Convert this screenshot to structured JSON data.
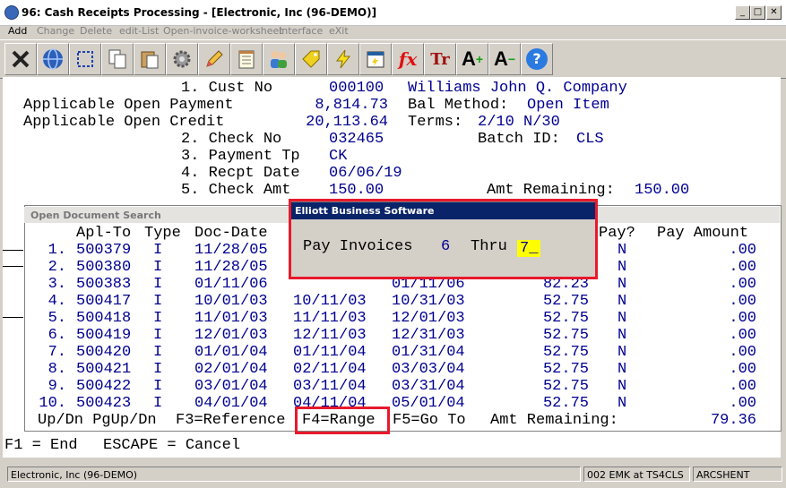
{
  "window": {
    "title": "96: Cash Receipts Processing - [Electronic, Inc (96-DEMO)]",
    "minimize_glyph": "_",
    "maximize_glyph": "□",
    "close_glyph": "✕"
  },
  "menu": [
    "Add",
    "Change",
    "Delete",
    "edit-List",
    "Open-invoice-worksheet",
    "Interface",
    "eXit"
  ],
  "toolbar": {
    "icons": [
      "exit-icon",
      "globe-icon",
      "select-icon",
      "copy-icon",
      "paste-icon",
      "settings-icon",
      "edit-icon",
      "notepad-icon",
      "users-icon",
      "tag-icon",
      "lightning-icon",
      "calendar-icon",
      "fx-icon",
      "font-icon",
      "font-larger-icon",
      "font-smaller-icon",
      "help-icon"
    ],
    "fx_label": "fx",
    "font_label": "Tr",
    "font_larger_label": "A",
    "font_larger_mark": "+",
    "font_smaller_label": "A",
    "font_smaller_mark": "−",
    "help_label": "?"
  },
  "header": {
    "cust_no_label": "1. Cust No",
    "cust_no": "000100",
    "customer_name": "Williams John Q. Company",
    "open_payment_label": "Applicable Open Payment",
    "open_payment": "8,814.73",
    "bal_method_label": "Bal Method:",
    "bal_method": "Open Item",
    "open_credit_label": "Applicable Open Credit",
    "open_credit": "20,113.64",
    "terms_label": "Terms:",
    "terms": "2/10 N/30",
    "check_no_label": "2. Check No",
    "check_no": "032465",
    "batch_label": "Batch ID:",
    "batch_id": "CLS",
    "payment_tp_label": "3. Payment Tp",
    "payment_tp": "CK",
    "recpt_date_label": "4. Recpt Date",
    "recpt_date": "06/06/19",
    "check_amt_label": "5. Check Amt",
    "check_amt": "150.00",
    "amt_remaining_label": "Amt Remaining:",
    "amt_remaining": "150.00"
  },
  "doc_search": {
    "title": "Open Document Search",
    "col_apl_to": "Apl-To",
    "col_type": "Type",
    "col_doc_date": "Doc-Date",
    "col_pay": "Pay?",
    "col_pay_amount": "Pay Amount",
    "rows": [
      {
        "n": "1.",
        "apl": "500379",
        "type": "I",
        "doc": "11/28/05",
        "disc": "",
        "due": "",
        "amt": "",
        "pay": "N",
        "pay_amt": ".00"
      },
      {
        "n": "2.",
        "apl": "500380",
        "type": "I",
        "doc": "11/28/05",
        "disc": "",
        "due": "",
        "amt": "",
        "pay": "N",
        "pay_amt": ".00"
      },
      {
        "n": "3.",
        "apl": "500383",
        "type": "I",
        "doc": "01/11/06",
        "disc": "",
        "due": "01/11/06",
        "amt": "82.23",
        "pay": "N",
        "pay_amt": ".00"
      },
      {
        "n": "4.",
        "apl": "500417",
        "type": "I",
        "doc": "10/01/03",
        "disc": "10/11/03",
        "due": "10/31/03",
        "amt": "52.75",
        "pay": "N",
        "pay_amt": ".00"
      },
      {
        "n": "5.",
        "apl": "500418",
        "type": "I",
        "doc": "11/01/03",
        "disc": "11/11/03",
        "due": "12/01/03",
        "amt": "52.75",
        "pay": "N",
        "pay_amt": ".00"
      },
      {
        "n": "6.",
        "apl": "500419",
        "type": "I",
        "doc": "12/01/03",
        "disc": "12/11/03",
        "due": "12/31/03",
        "amt": "52.75",
        "pay": "N",
        "pay_amt": ".00"
      },
      {
        "n": "7.",
        "apl": "500420",
        "type": "I",
        "doc": "01/01/04",
        "disc": "01/11/04",
        "due": "01/31/04",
        "amt": "52.75",
        "pay": "N",
        "pay_amt": ".00"
      },
      {
        "n": "8.",
        "apl": "500421",
        "type": "I",
        "doc": "02/01/04",
        "disc": "02/11/04",
        "due": "03/03/04",
        "amt": "52.75",
        "pay": "N",
        "pay_amt": ".00"
      },
      {
        "n": "9.",
        "apl": "500422",
        "type": "I",
        "doc": "03/01/04",
        "disc": "03/11/04",
        "due": "03/31/04",
        "amt": "52.75",
        "pay": "N",
        "pay_amt": ".00"
      },
      {
        "n": "10.",
        "apl": "500423",
        "type": "I",
        "doc": "04/01/04",
        "disc": "04/11/04",
        "due": "05/01/04",
        "amt": "52.75",
        "pay": "N",
        "pay_amt": ".00"
      }
    ],
    "footer": {
      "nav": "Up/Dn PgUp/Dn",
      "f3": "F3=Reference",
      "f4": "F4=Range",
      "f5": "F5=Go To",
      "remaining_label": "Amt Remaining:",
      "remaining": "79.36"
    }
  },
  "pay_dialog": {
    "title": "Elliott Business Software",
    "pay_label": "Pay Invoices",
    "from": "6",
    "thru_label": "Thru",
    "thru_value": "7_"
  },
  "keys": {
    "f1": "F1 = End",
    "escape": "ESCAPE = Cancel"
  },
  "status": {
    "company": "Electronic, Inc (96-DEMO)",
    "session": "002 EMK at TS4CLS",
    "host": "ARCSHENT"
  }
}
